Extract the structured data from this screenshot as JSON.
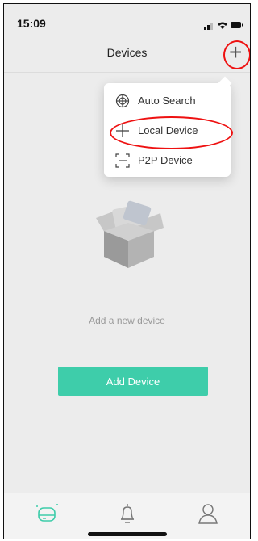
{
  "status_bar": {
    "time": "15:09"
  },
  "header": {
    "title": "Devices",
    "add_icon": "plus-icon"
  },
  "popup_menu": {
    "items": [
      {
        "label": "Auto Search",
        "icon": "auto-search-icon"
      },
      {
        "label": "Local Device",
        "icon": "plus-icon"
      },
      {
        "label": "P2P Device",
        "icon": "scan-icon"
      }
    ]
  },
  "empty_state": {
    "message": "Add a new device",
    "button_label": "Add Device"
  },
  "tab_bar": {
    "tabs": [
      {
        "icon": "devices-icon",
        "active": true
      },
      {
        "icon": "bell-icon",
        "active": false
      },
      {
        "icon": "user-icon",
        "active": false
      }
    ]
  },
  "colors": {
    "accent": "#3ecdaa",
    "annotation_red": "#e11111",
    "background": "#ececec"
  }
}
